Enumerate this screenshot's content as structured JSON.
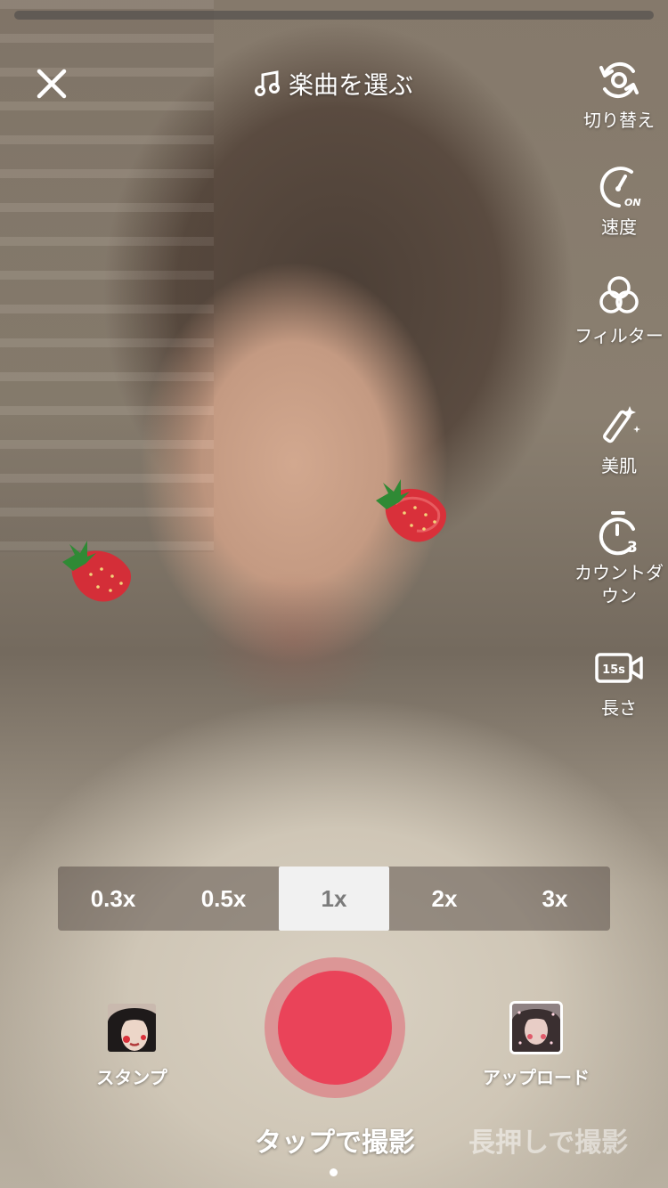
{
  "top": {
    "music_label": "楽曲を選ぶ"
  },
  "side_tools": [
    {
      "label": "切り替え",
      "icon": "flip-camera-icon"
    },
    {
      "label": "速度",
      "icon": "speed-icon",
      "badge": "ON"
    },
    {
      "label": "フィルター",
      "icon": "filter-icon"
    },
    {
      "label": "美肌",
      "icon": "beauty-wand-icon"
    },
    {
      "label": "カウントダウン",
      "icon": "timer-icon",
      "badge": "3"
    },
    {
      "label": "長さ",
      "icon": "video-length-icon",
      "badge": "15s"
    }
  ],
  "zoom": {
    "options": [
      "0.3x",
      "0.5x",
      "1x",
      "2x",
      "3x"
    ],
    "selected": "1x"
  },
  "bottom": {
    "stamp_label": "スタンプ",
    "upload_label": "アップロード"
  },
  "modes": {
    "active": "タップで撮影",
    "inactive": "長押しで撮影"
  },
  "colors": {
    "record": "#ea4359",
    "record_ring": "#e25064"
  }
}
